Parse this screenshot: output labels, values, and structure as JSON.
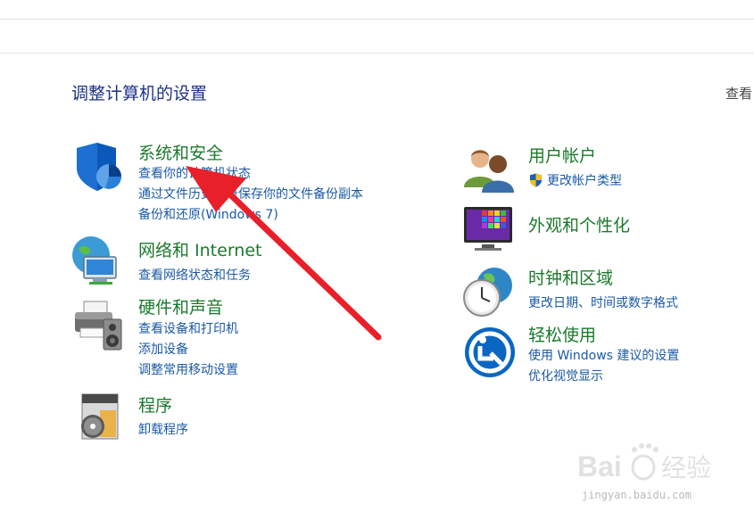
{
  "header": {
    "title": "调整计算机的设置",
    "view_by": "查看"
  },
  "left": [
    {
      "title": "系统和安全",
      "icon": "security-shield-icon",
      "links": [
        "查看你的计算机状态",
        "通过文件历史记录保存你的文件备份副本",
        "备份和还原(Windows 7)"
      ]
    },
    {
      "title": "网络和 Internet",
      "icon": "network-globe-icon",
      "links": [
        "查看网络状态和任务"
      ]
    },
    {
      "title": "硬件和声音",
      "icon": "printer-speaker-icon",
      "links": [
        "查看设备和打印机",
        "添加设备",
        "调整常用移动设置"
      ]
    },
    {
      "title": "程序",
      "icon": "programs-disc-icon",
      "links": [
        "卸载程序"
      ]
    }
  ],
  "right": [
    {
      "title": "用户帐户",
      "icon": "user-accounts-icon",
      "links": [
        "更改帐户类型"
      ]
    },
    {
      "title": "外观和个性化",
      "icon": "appearance-monitor-icon",
      "links": []
    },
    {
      "title": "时钟和区域",
      "icon": "clock-globe-icon",
      "links": [
        "更改日期、时间或数字格式"
      ]
    },
    {
      "title": "轻松使用",
      "icon": "ease-of-access-icon",
      "links": [
        "使用 Windows 建议的设置",
        "优化视觉显示"
      ]
    }
  ],
  "watermark": {
    "logo": "Baidu经验",
    "url": "jingyan.baidu.com"
  },
  "colors": {
    "title_blue": "#1e3287",
    "category_green": "#1a7a2b",
    "link_blue": "#1a59a6",
    "arrow_red": "#e8202a"
  }
}
